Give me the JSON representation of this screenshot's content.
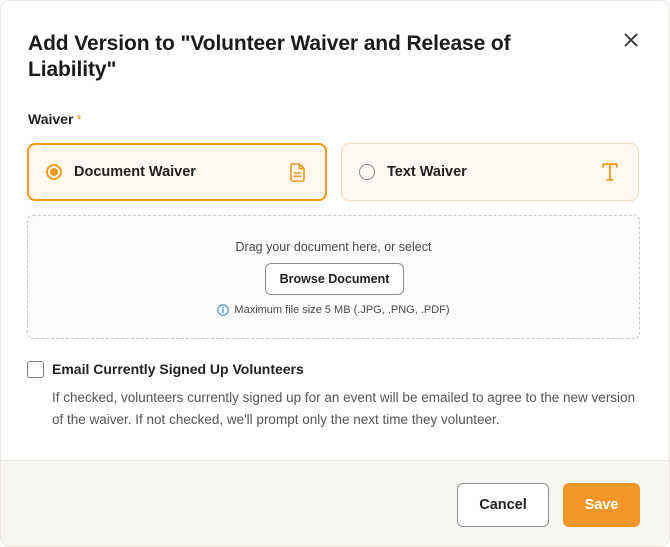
{
  "dialog": {
    "title": "Add Version to \"Volunteer Waiver and Release of Liability\"",
    "close_icon": "close-icon"
  },
  "waiver": {
    "label": "Waiver",
    "required_mark": "*",
    "options": [
      {
        "label": "Document Waiver",
        "selected": true,
        "icon": "document-icon"
      },
      {
        "label": "Text Waiver",
        "selected": false,
        "icon": "text-icon"
      }
    ]
  },
  "upload": {
    "drag_text": "Drag your document here, or select",
    "browse_label": "Browse Document",
    "max_size_text": "Maximum file size 5 MB (.JPG, .PNG, .PDF)",
    "info_icon": "info-icon"
  },
  "email_option": {
    "label": "Email Currently Signed Up Volunteers",
    "checked": false,
    "help": "If checked, volunteers currently signed up for an event will be emailed to agree to the new version of the waiver. If not checked, we'll prompt only the next time they volunteer."
  },
  "footer": {
    "cancel_label": "Cancel",
    "save_label": "Save"
  },
  "colors": {
    "accent": "#f29a1f",
    "save_button": "#f2962a",
    "option_background": "#fef8f0",
    "info_icon": "#3b8fd6"
  }
}
